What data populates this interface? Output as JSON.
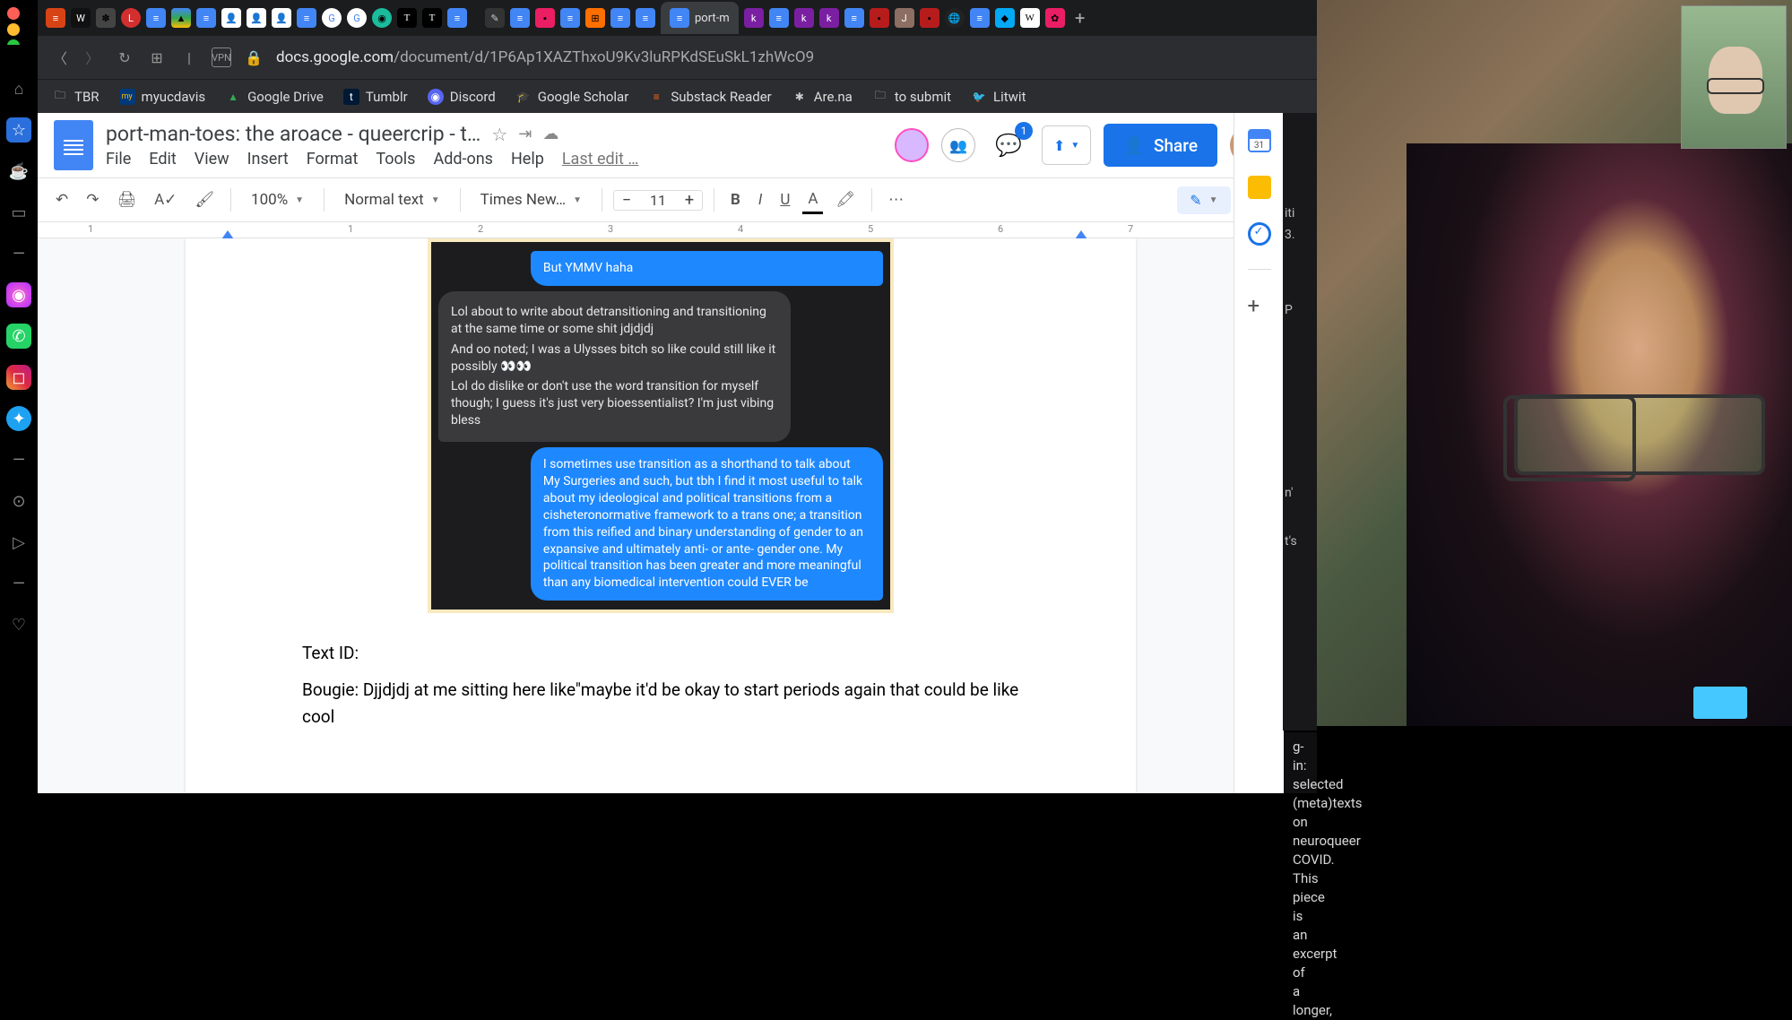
{
  "window_dots": [
    "close",
    "minimize",
    "zoom"
  ],
  "tab_strip": {
    "active": {
      "label": "port-m",
      "icon": "docs"
    }
  },
  "url_bar": {
    "host": "docs.google.com",
    "path": "/document/d/1P6Ap1XAZThxoU9Kv3luRPKdSEuSkL1zhWcO9"
  },
  "bookmarks": [
    {
      "icon": "folder",
      "label": "TBR"
    },
    {
      "icon": "my",
      "label": "myucdavis"
    },
    {
      "icon": "drive",
      "label": "Google Drive"
    },
    {
      "icon": "t",
      "label": "Tumblr"
    },
    {
      "icon": "discord",
      "label": "Discord"
    },
    {
      "icon": "scholar",
      "label": "Google Scholar"
    },
    {
      "icon": "substack",
      "label": "Substack Reader"
    },
    {
      "icon": "arena",
      "label": "Are.na"
    },
    {
      "icon": "folder",
      "label": "to submit"
    },
    {
      "icon": "twitter",
      "label": "Litwit"
    }
  ],
  "docs": {
    "title": "port-man-toes: the aroace - queercrip - t…",
    "menus": [
      "File",
      "Edit",
      "View",
      "Insert",
      "Format",
      "Tools",
      "Add-ons",
      "Help"
    ],
    "last_edit": "Last edit …",
    "comments_badge": "1",
    "share": "Share",
    "toolbar": {
      "zoom": "100%",
      "style": "Normal text",
      "font": "Times New…",
      "size": "11",
      "calendar_day": "31"
    },
    "ruler_ticks": [
      "1",
      "1",
      "2",
      "3",
      "4",
      "5",
      "6",
      "7"
    ]
  },
  "chat": {
    "blue_top": "But YMMV haha",
    "gray": {
      "p1": "Lol about to write about detransitioning and transitioning at the same time or some shit jdjdjdj",
      "p2": "And oo noted; I was a Ulysses bitch so like could still like it possibly 👀👀",
      "p3": "Lol do dislike or don't use the word transition for myself though; I guess it's just very bioessentialist? I'm just vibing bless"
    },
    "blue_long": "I sometimes use transition as a shorthand to talk about My Surgeries and such, but tbh I find it most useful to talk about my ideological and political transitions from a cisheteronormative framework to a trans one; a transition from this reified and binary understanding of gender to an expansive and ultimately anti- or ante- gender one. My political transition has been greater and more meaningful than any biomedical intervention could EVER be"
  },
  "doc_body": {
    "id_line": "Text ID:",
    "line2": "Bougie: Djjdjdj at me sitting here like\"maybe it'd be okay to start periods again that could be like cool"
  },
  "caption": {
    "l1": "g-in: selected (meta)texts on neuroqueer",
    "l2": "COVID. This piece is an excerpt of a longer,"
  },
  "peek": [
    "iti",
    "3.",
    "P",
    "n'",
    "t's"
  ]
}
